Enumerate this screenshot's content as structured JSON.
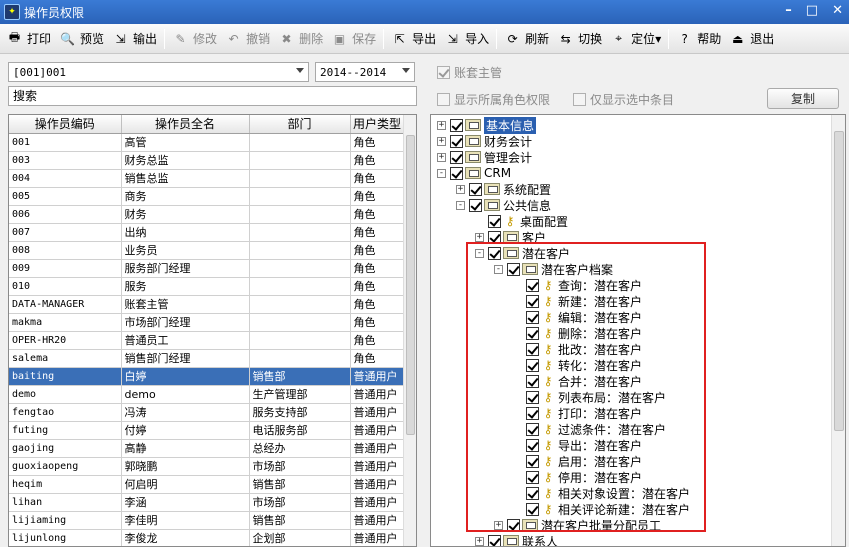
{
  "window": {
    "title": "操作员权限"
  },
  "toolbar": [
    {
      "label": "打印",
      "icon": "print-icon",
      "enabled": true
    },
    {
      "label": "预览",
      "icon": "preview-icon",
      "enabled": true
    },
    {
      "label": "输出",
      "icon": "output-icon",
      "enabled": true
    },
    {
      "label": "修改",
      "icon": "edit-icon",
      "enabled": false
    },
    {
      "label": "撤销",
      "icon": "undo-icon",
      "enabled": false
    },
    {
      "label": "删除",
      "icon": "delete-icon",
      "enabled": false
    },
    {
      "label": "保存",
      "icon": "save-icon",
      "enabled": false
    },
    {
      "label": "导出",
      "icon": "export-icon",
      "enabled": true
    },
    {
      "label": "导入",
      "icon": "import-icon",
      "enabled": true
    },
    {
      "label": "刷新",
      "icon": "refresh-icon",
      "enabled": true
    },
    {
      "label": "切换",
      "icon": "switch-icon",
      "enabled": true
    },
    {
      "label": "定位",
      "icon": "locate-icon",
      "enabled": true
    },
    {
      "label": "帮助",
      "icon": "help-icon",
      "enabled": true
    },
    {
      "label": "退出",
      "icon": "exit-icon",
      "enabled": true
    }
  ],
  "filters": {
    "account": "[001]001",
    "year": "2014--2014",
    "search_label": "搜索"
  },
  "options": {
    "account_master": "账套主管",
    "show_role_perms": "显示所属角色权限",
    "only_selected": "仅显示选中条目",
    "copy": "复制"
  },
  "grid": {
    "headers": [
      "操作员编码",
      "操作员全名",
      "部门",
      "用户类型"
    ],
    "rows": [
      [
        "001",
        "高管",
        "",
        "角色"
      ],
      [
        "003",
        "财务总监",
        "",
        "角色"
      ],
      [
        "004",
        "销售总监",
        "",
        "角色"
      ],
      [
        "005",
        "商务",
        "",
        "角色"
      ],
      [
        "006",
        "财务",
        "",
        "角色"
      ],
      [
        "007",
        "出纳",
        "",
        "角色"
      ],
      [
        "008",
        "业务员",
        "",
        "角色"
      ],
      [
        "009",
        "服务部门经理",
        "",
        "角色"
      ],
      [
        "010",
        "服务",
        "",
        "角色"
      ],
      [
        "DATA-MANAGER",
        "账套主管",
        "",
        "角色"
      ],
      [
        "makma",
        "市场部门经理",
        "",
        "角色"
      ],
      [
        "OPER-HR20",
        "普通员工",
        "",
        "角色"
      ],
      [
        "salema",
        "销售部门经理",
        "",
        "角色"
      ],
      [
        "baiting",
        "白婷",
        "销售部",
        "普通用户"
      ],
      [
        "demo",
        "demo",
        "生产管理部",
        "普通用户"
      ],
      [
        "fengtao",
        "冯涛",
        "服务支持部",
        "普通用户"
      ],
      [
        "futing",
        "付婷",
        "电话服务部",
        "普通用户"
      ],
      [
        "gaojing",
        "高静",
        "总经办",
        "普通用户"
      ],
      [
        "guoxiaopeng",
        "郭晓鹏",
        "市场部",
        "普通用户"
      ],
      [
        "heqim",
        "何启明",
        "销售部",
        "普通用户"
      ],
      [
        "lihan",
        "李涵",
        "市场部",
        "普通用户"
      ],
      [
        "lijiaming",
        "李佳明",
        "销售部",
        "普通用户"
      ],
      [
        "lijunlong",
        "李俊龙",
        "企划部",
        "普通用户"
      ]
    ],
    "selected_row": 13
  },
  "tree": [
    {
      "label": "基本信息",
      "level": 0,
      "exp": "+",
      "type": "folder",
      "highlight": true
    },
    {
      "label": "财务会计",
      "level": 0,
      "exp": "+",
      "type": "folder"
    },
    {
      "label": "管理会计",
      "level": 0,
      "exp": "+",
      "type": "folder"
    },
    {
      "label": "CRM",
      "level": 0,
      "exp": "-",
      "type": "folder"
    },
    {
      "label": "系统配置",
      "level": 1,
      "exp": "+",
      "type": "folder"
    },
    {
      "label": "公共信息",
      "level": 1,
      "exp": "-",
      "type": "folder"
    },
    {
      "label": "桌面配置",
      "level": 2,
      "exp": "",
      "type": "key"
    },
    {
      "label": "客户",
      "level": 2,
      "exp": "+",
      "type": "folder"
    },
    {
      "label": "潜在客户",
      "level": 2,
      "exp": "-",
      "type": "folder"
    },
    {
      "label": "潜在客户档案",
      "level": 3,
      "exp": "-",
      "type": "folder"
    },
    {
      "label": "查询：潜在客户",
      "level": 4,
      "exp": "",
      "type": "key"
    },
    {
      "label": "新建：潜在客户",
      "level": 4,
      "exp": "",
      "type": "key"
    },
    {
      "label": "编辑：潜在客户",
      "level": 4,
      "exp": "",
      "type": "key"
    },
    {
      "label": "删除：潜在客户",
      "level": 4,
      "exp": "",
      "type": "key"
    },
    {
      "label": "批改：潜在客户",
      "level": 4,
      "exp": "",
      "type": "key"
    },
    {
      "label": "转化：潜在客户",
      "level": 4,
      "exp": "",
      "type": "key"
    },
    {
      "label": "合并：潜在客户",
      "level": 4,
      "exp": "",
      "type": "key"
    },
    {
      "label": "列表布局：潜在客户",
      "level": 4,
      "exp": "",
      "type": "key"
    },
    {
      "label": "打印：潜在客户",
      "level": 4,
      "exp": "",
      "type": "key"
    },
    {
      "label": "过滤条件：潜在客户",
      "level": 4,
      "exp": "",
      "type": "key"
    },
    {
      "label": "导出：潜在客户",
      "level": 4,
      "exp": "",
      "type": "key"
    },
    {
      "label": "启用：潜在客户",
      "level": 4,
      "exp": "",
      "type": "key"
    },
    {
      "label": "停用：潜在客户",
      "level": 4,
      "exp": "",
      "type": "key"
    },
    {
      "label": "相关对象设置：潜在客户",
      "level": 4,
      "exp": "",
      "type": "key"
    },
    {
      "label": "相关评论新建：潜在客户",
      "level": 4,
      "exp": "",
      "type": "key"
    },
    {
      "label": "潜在客户批量分配员工",
      "level": 3,
      "exp": "+",
      "type": "folder"
    },
    {
      "label": "联系人",
      "level": 2,
      "exp": "+",
      "type": "folder"
    }
  ]
}
